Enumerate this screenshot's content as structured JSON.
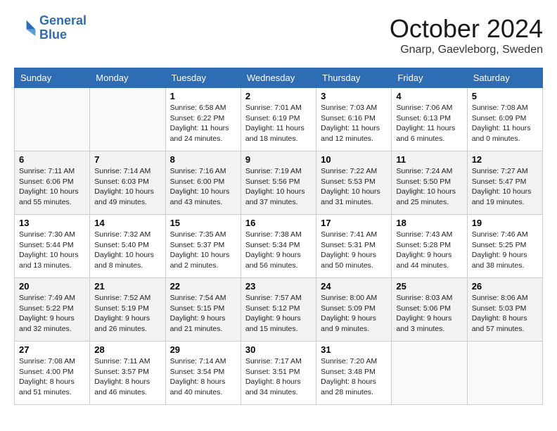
{
  "header": {
    "logo_line1": "General",
    "logo_line2": "Blue",
    "month": "October 2024",
    "location": "Gnarp, Gaevleborg, Sweden"
  },
  "weekdays": [
    "Sunday",
    "Monday",
    "Tuesday",
    "Wednesday",
    "Thursday",
    "Friday",
    "Saturday"
  ],
  "weeks": [
    [
      {
        "day": "",
        "info": ""
      },
      {
        "day": "",
        "info": ""
      },
      {
        "day": "1",
        "info": "Sunrise: 6:58 AM\nSunset: 6:22 PM\nDaylight: 11 hours and 24 minutes."
      },
      {
        "day": "2",
        "info": "Sunrise: 7:01 AM\nSunset: 6:19 PM\nDaylight: 11 hours and 18 minutes."
      },
      {
        "day": "3",
        "info": "Sunrise: 7:03 AM\nSunset: 6:16 PM\nDaylight: 11 hours and 12 minutes."
      },
      {
        "day": "4",
        "info": "Sunrise: 7:06 AM\nSunset: 6:13 PM\nDaylight: 11 hours and 6 minutes."
      },
      {
        "day": "5",
        "info": "Sunrise: 7:08 AM\nSunset: 6:09 PM\nDaylight: 11 hours and 0 minutes."
      }
    ],
    [
      {
        "day": "6",
        "info": "Sunrise: 7:11 AM\nSunset: 6:06 PM\nDaylight: 10 hours and 55 minutes."
      },
      {
        "day": "7",
        "info": "Sunrise: 7:14 AM\nSunset: 6:03 PM\nDaylight: 10 hours and 49 minutes."
      },
      {
        "day": "8",
        "info": "Sunrise: 7:16 AM\nSunset: 6:00 PM\nDaylight: 10 hours and 43 minutes."
      },
      {
        "day": "9",
        "info": "Sunrise: 7:19 AM\nSunset: 5:56 PM\nDaylight: 10 hours and 37 minutes."
      },
      {
        "day": "10",
        "info": "Sunrise: 7:22 AM\nSunset: 5:53 PM\nDaylight: 10 hours and 31 minutes."
      },
      {
        "day": "11",
        "info": "Sunrise: 7:24 AM\nSunset: 5:50 PM\nDaylight: 10 hours and 25 minutes."
      },
      {
        "day": "12",
        "info": "Sunrise: 7:27 AM\nSunset: 5:47 PM\nDaylight: 10 hours and 19 minutes."
      }
    ],
    [
      {
        "day": "13",
        "info": "Sunrise: 7:30 AM\nSunset: 5:44 PM\nDaylight: 10 hours and 13 minutes."
      },
      {
        "day": "14",
        "info": "Sunrise: 7:32 AM\nSunset: 5:40 PM\nDaylight: 10 hours and 8 minutes."
      },
      {
        "day": "15",
        "info": "Sunrise: 7:35 AM\nSunset: 5:37 PM\nDaylight: 10 hours and 2 minutes."
      },
      {
        "day": "16",
        "info": "Sunrise: 7:38 AM\nSunset: 5:34 PM\nDaylight: 9 hours and 56 minutes."
      },
      {
        "day": "17",
        "info": "Sunrise: 7:41 AM\nSunset: 5:31 PM\nDaylight: 9 hours and 50 minutes."
      },
      {
        "day": "18",
        "info": "Sunrise: 7:43 AM\nSunset: 5:28 PM\nDaylight: 9 hours and 44 minutes."
      },
      {
        "day": "19",
        "info": "Sunrise: 7:46 AM\nSunset: 5:25 PM\nDaylight: 9 hours and 38 minutes."
      }
    ],
    [
      {
        "day": "20",
        "info": "Sunrise: 7:49 AM\nSunset: 5:22 PM\nDaylight: 9 hours and 32 minutes."
      },
      {
        "day": "21",
        "info": "Sunrise: 7:52 AM\nSunset: 5:19 PM\nDaylight: 9 hours and 26 minutes."
      },
      {
        "day": "22",
        "info": "Sunrise: 7:54 AM\nSunset: 5:15 PM\nDaylight: 9 hours and 21 minutes."
      },
      {
        "day": "23",
        "info": "Sunrise: 7:57 AM\nSunset: 5:12 PM\nDaylight: 9 hours and 15 minutes."
      },
      {
        "day": "24",
        "info": "Sunrise: 8:00 AM\nSunset: 5:09 PM\nDaylight: 9 hours and 9 minutes."
      },
      {
        "day": "25",
        "info": "Sunrise: 8:03 AM\nSunset: 5:06 PM\nDaylight: 9 hours and 3 minutes."
      },
      {
        "day": "26",
        "info": "Sunrise: 8:06 AM\nSunset: 5:03 PM\nDaylight: 8 hours and 57 minutes."
      }
    ],
    [
      {
        "day": "27",
        "info": "Sunrise: 7:08 AM\nSunset: 4:00 PM\nDaylight: 8 hours and 51 minutes."
      },
      {
        "day": "28",
        "info": "Sunrise: 7:11 AM\nSunset: 3:57 PM\nDaylight: 8 hours and 46 minutes."
      },
      {
        "day": "29",
        "info": "Sunrise: 7:14 AM\nSunset: 3:54 PM\nDaylight: 8 hours and 40 minutes."
      },
      {
        "day": "30",
        "info": "Sunrise: 7:17 AM\nSunset: 3:51 PM\nDaylight: 8 hours and 34 minutes."
      },
      {
        "day": "31",
        "info": "Sunrise: 7:20 AM\nSunset: 3:48 PM\nDaylight: 8 hours and 28 minutes."
      },
      {
        "day": "",
        "info": ""
      },
      {
        "day": "",
        "info": ""
      }
    ]
  ]
}
